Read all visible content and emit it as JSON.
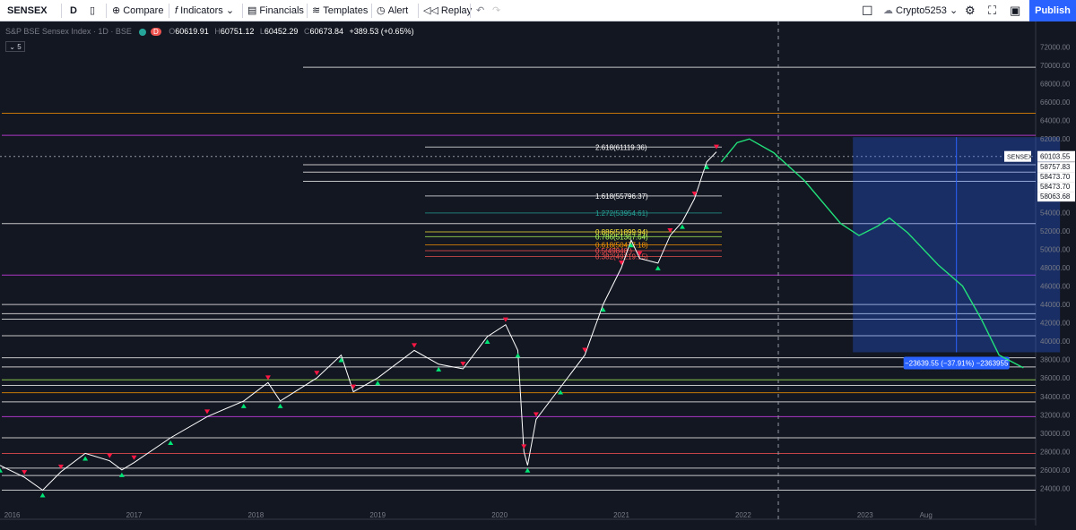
{
  "toolbar": {
    "symbol": "SENSEX",
    "interval": "D",
    "compare": "Compare",
    "indicators": "Indicators",
    "financials": "Financials",
    "templates": "Templates",
    "alert": "Alert",
    "replay": "Replay",
    "layout_name": "Crypto5253",
    "publish": "Publish"
  },
  "legend": {
    "title": "S&P BSE Sensex Index · 1D · BSE",
    "badge": "D",
    "open": "60619.91",
    "high": "60751.12",
    "low": "60452.29",
    "close": "60673.84",
    "change": "+389.53 (+0.65%)",
    "collapse": "5"
  },
  "colors": {
    "background": "#131722",
    "price_line": "#ffffff",
    "projection": "#22e07a",
    "accent": "#2962ff",
    "bull_marker": "#00e676",
    "bear_marker": "#ff1744"
  },
  "chart_data": {
    "type": "line",
    "title": "S&P BSE Sensex Index · 1D · BSE",
    "xlabel": "",
    "ylabel": "",
    "ylim": [
      22000,
      74000
    ],
    "xlim": [
      2015.9,
      2024.4
    ],
    "grid": false,
    "yticks": [
      24000,
      26000,
      28000,
      30000,
      32000,
      34000,
      36000,
      38000,
      40000,
      42000,
      44000,
      46000,
      48000,
      50000,
      52000,
      54000,
      56000,
      58000,
      60000,
      62000,
      64000,
      66000,
      68000,
      70000,
      72000
    ],
    "xticks": [
      {
        "x": 2016,
        "label": "2016"
      },
      {
        "x": 2017,
        "label": "2017"
      },
      {
        "x": 2018,
        "label": "2018"
      },
      {
        "x": 2019,
        "label": "2019"
      },
      {
        "x": 2020,
        "label": "2020"
      },
      {
        "x": 2021,
        "label": "2021"
      },
      {
        "x": 2022,
        "label": "2022"
      },
      {
        "x": 2023,
        "label": "2023"
      },
      {
        "x": 2023.5,
        "label": "Aug"
      }
    ],
    "current_price": {
      "label": "SENSEX",
      "value": "60103.55"
    },
    "price_labels": [
      "58757.83",
      "58473.70",
      "58473.70",
      "58063.68"
    ],
    "series": [
      {
        "values": [
          [
            2015.9,
            26500
          ],
          [
            2016.1,
            25200
          ],
          [
            2016.25,
            23800
          ],
          [
            2016.4,
            25800
          ],
          [
            2016.6,
            27800
          ],
          [
            2016.8,
            27000
          ],
          [
            2016.9,
            26000
          ],
          [
            2017.0,
            26800
          ],
          [
            2017.3,
            29500
          ],
          [
            2017.6,
            31800
          ],
          [
            2017.9,
            33500
          ],
          [
            2018.1,
            35500
          ],
          [
            2018.2,
            33500
          ],
          [
            2018.5,
            36000
          ],
          [
            2018.7,
            38500
          ],
          [
            2018.8,
            34500
          ],
          [
            2019.0,
            36000
          ],
          [
            2019.3,
            39000
          ],
          [
            2019.5,
            37500
          ],
          [
            2019.7,
            37000
          ],
          [
            2019.9,
            40500
          ],
          [
            2020.05,
            41800
          ],
          [
            2020.15,
            39000
          ],
          [
            2020.2,
            28000
          ],
          [
            2020.23,
            26500
          ],
          [
            2020.3,
            31500
          ],
          [
            2020.5,
            35000
          ],
          [
            2020.7,
            38500
          ],
          [
            2020.85,
            44000
          ],
          [
            2021.0,
            48000
          ],
          [
            2021.08,
            51000
          ],
          [
            2021.15,
            49000
          ],
          [
            2021.3,
            48500
          ],
          [
            2021.4,
            51500
          ],
          [
            2021.5,
            53000
          ],
          [
            2021.6,
            55500
          ],
          [
            2021.7,
            59500
          ],
          [
            2021.78,
            60600
          ]
        ]
      },
      {
        "values": [
          [
            2021.82,
            59500
          ],
          [
            2021.95,
            61600
          ],
          [
            2022.05,
            62000
          ],
          [
            2022.25,
            60500
          ],
          [
            2022.5,
            57500
          ],
          [
            2022.8,
            52800
          ],
          [
            2022.95,
            51500
          ],
          [
            2023.1,
            52500
          ],
          [
            2023.2,
            53400
          ],
          [
            2023.35,
            51800
          ],
          [
            2023.6,
            48300
          ],
          [
            2023.8,
            46000
          ],
          [
            2023.95,
            42500
          ],
          [
            2024.1,
            38500
          ],
          [
            2024.3,
            37100
          ]
        ]
      }
    ],
    "fib_levels": [
      {
        "ratio": "2.618",
        "value": 61119.36,
        "text": "2.618(61119.36)"
      },
      {
        "ratio": "1.618",
        "value": 55796.37,
        "text": "1.618(55796.37)"
      },
      {
        "ratio": "1.272",
        "value": 53954.61,
        "text": "1.272(53954.61)"
      },
      {
        "ratio": "0.886",
        "value": 51899.94,
        "text": "0.886(51899.94)"
      },
      {
        "ratio": "0.786",
        "value": 51367.64,
        "text": "0.786(51367.64)"
      },
      {
        "ratio": "0.618",
        "value": 50477.18,
        "text": "0.618(50477.18)"
      },
      {
        "ratio": "0.5",
        "value": 49848,
        "text": "0.5(49848.)"
      },
      {
        "ratio": "0.382",
        "value": 49219.15,
        "text": "0.382(49219.15)"
      }
    ],
    "horizontal_levels": [
      69800,
      64800,
      62400,
      59200,
      58400,
      57400,
      52800,
      47200,
      44000,
      43000,
      42400,
      40600,
      38200,
      37200,
      35800,
      35200,
      34400,
      33400,
      31800,
      29500,
      27800,
      26200,
      25400,
      23800
    ],
    "projection_box": {
      "x0": 2022.9,
      "x1": 2024.6,
      "y0": 62200,
      "y1": 38800,
      "label": "−23639.55 (−37.91%) −2363955"
    }
  }
}
